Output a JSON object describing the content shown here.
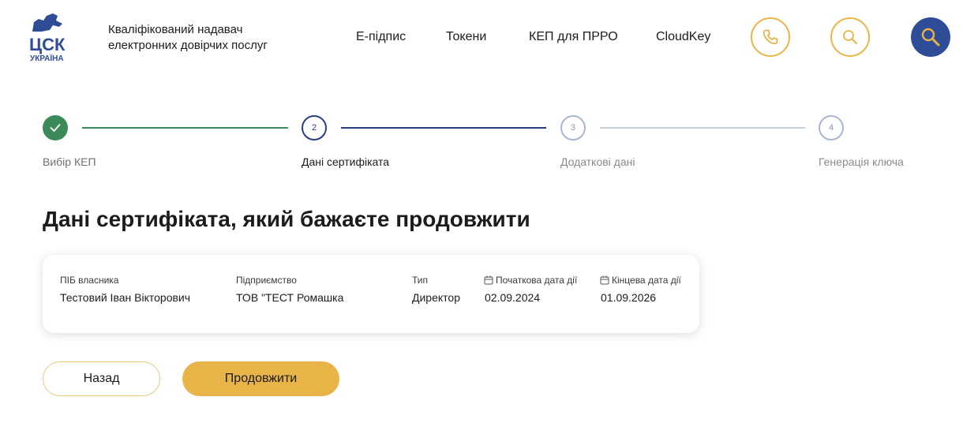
{
  "header": {
    "logo": {
      "text_main": "ЦСК",
      "text_sub": "УКРАЇНА"
    },
    "tagline_line1": "Кваліфікований надавач",
    "tagline_line2": "електронних довірчих послуг",
    "nav": [
      {
        "label": "Е-підпис"
      },
      {
        "label": "Токени"
      },
      {
        "label": "КЕП для ПРРО"
      },
      {
        "label": "CloudKey"
      }
    ],
    "buttons": {
      "phone_icon": "phone-icon",
      "search_icon": "search-icon",
      "key_search_icon": "key-search-icon"
    }
  },
  "stepper": {
    "steps": [
      {
        "number": "",
        "label": "Вибір КЕП",
        "status": "done"
      },
      {
        "number": "2",
        "label": "Дані сертифіката",
        "status": "active"
      },
      {
        "number": "3",
        "label": "Додаткові дані",
        "status": "pending"
      },
      {
        "number": "4",
        "label": "Генерація ключа",
        "status": "pending"
      }
    ]
  },
  "page": {
    "title": "Дані сертифіката, який бажаєте продовжити"
  },
  "certificate": {
    "owner_label": "ПІБ власника",
    "owner_value": "Тестовий Іван Вікторович",
    "company_label": "Підприємство",
    "company_value": "ТОВ \"ТЕСТ Ромашка",
    "type_label": "Тип",
    "type_value": "Директор",
    "start_label": "Початкова дата дії",
    "start_value": "02.09.2024",
    "end_label": "Кінцева дата дії",
    "end_value": "01.09.2026"
  },
  "actions": {
    "back_label": "Назад",
    "continue_label": "Продовжити"
  },
  "colors": {
    "brand_blue": "#2f4d97",
    "accent_gold": "#e8b347",
    "done_green": "#3c8a5a",
    "active_navy": "#2b3f7f",
    "pending_gray": "#a9b6cf"
  }
}
